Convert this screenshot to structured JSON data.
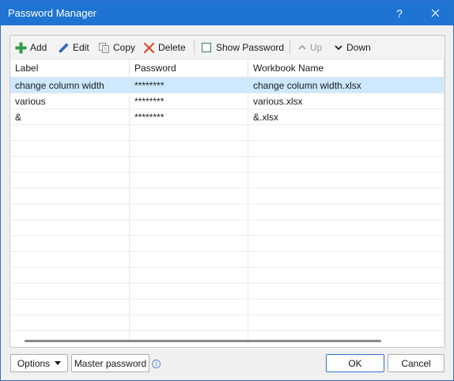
{
  "window": {
    "title": "Password Manager",
    "help_label": "?"
  },
  "toolbar": {
    "add": "Add",
    "edit": "Edit",
    "copy": "Copy",
    "delete": "Delete",
    "show_password": "Show Password",
    "up": "Up",
    "down": "Down"
  },
  "table": {
    "columns": [
      "Label",
      "Password",
      "Workbook Name"
    ],
    "rows": [
      {
        "label": "change column width",
        "password": "********",
        "workbook": "change column width.xlsx"
      },
      {
        "label": "various",
        "password": "********",
        "workbook": "various.xlsx"
      },
      {
        "label": "&",
        "password": "********",
        "workbook": "&.xlsx"
      }
    ]
  },
  "footer": {
    "options": "Options",
    "master_password": "Master password",
    "info_icon_glyph": "i",
    "ok": "OK",
    "cancel": "Cancel"
  },
  "colors": {
    "titlebar": "#1f73d3",
    "selection": "#cde8ff",
    "add_icon": "#2e9e4a",
    "delete_icon": "#e04a2a",
    "edit_icon": "#2b64c8"
  },
  "icons": [
    "plus-icon",
    "pencil-icon",
    "copy-icon",
    "delete-x-icon",
    "checkbox",
    "chevron-up-icon",
    "chevron-down-icon",
    "info-icon",
    "close-icon",
    "dropdown-arrow-icon"
  ]
}
